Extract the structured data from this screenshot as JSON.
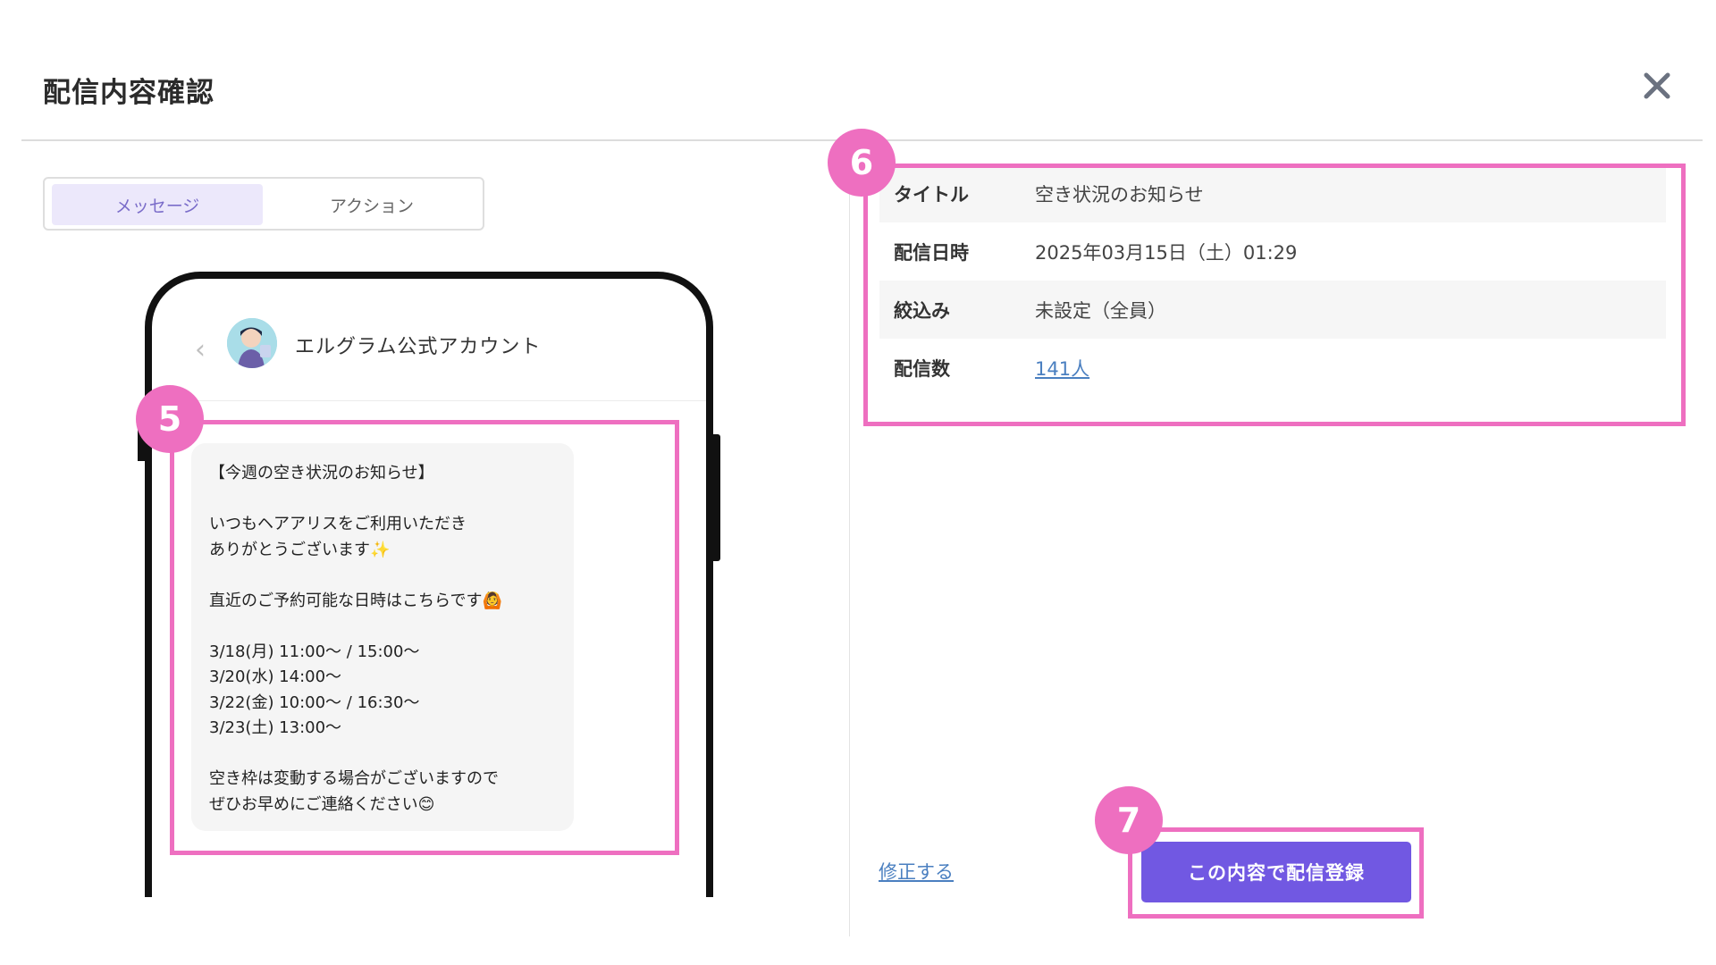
{
  "header": {
    "title": "配信内容確認"
  },
  "tabs": [
    {
      "label": "メッセージ",
      "active": true
    },
    {
      "label": "アクション",
      "active": false
    }
  ],
  "phone": {
    "account_name": "エルグラム公式アカウント",
    "message_lines": [
      "【今週の空き状況のお知らせ】",
      "",
      "いつもヘアアリスをご利用いただき",
      "ありがとうございます✨",
      "",
      "直近のご予約可能な日時はこちらです🙆",
      "",
      "3/18(月) 11:00〜 / 15:00〜",
      "3/20(水) 14:00〜",
      "3/22(金) 10:00〜 / 16:30〜",
      "3/23(土) 13:00〜",
      "",
      "空き枠は変動する場合がございますので",
      "ぜひお早めにご連絡ください😊"
    ]
  },
  "info": {
    "rows": [
      {
        "label": "タイトル",
        "value": "空き状況のお知らせ"
      },
      {
        "label": "配信日時",
        "value": "2025年03月15日（土）01:29"
      },
      {
        "label": "絞込み",
        "value": "未設定（全員）"
      },
      {
        "label": "配信数",
        "value": "141人"
      }
    ]
  },
  "footer": {
    "edit_label": "修正する",
    "submit_label": "この内容で配信登録"
  },
  "badges": {
    "message": "5",
    "info": "6",
    "submit": "7"
  },
  "colors": {
    "accent": "#7158e2",
    "highlight": "#ee6fc0",
    "link": "#4a7fc0",
    "tab_active_bg": "#ece8fb"
  },
  "icons": {
    "close": "close-icon",
    "back": "chevron-left-icon",
    "avatar": "account-avatar"
  }
}
